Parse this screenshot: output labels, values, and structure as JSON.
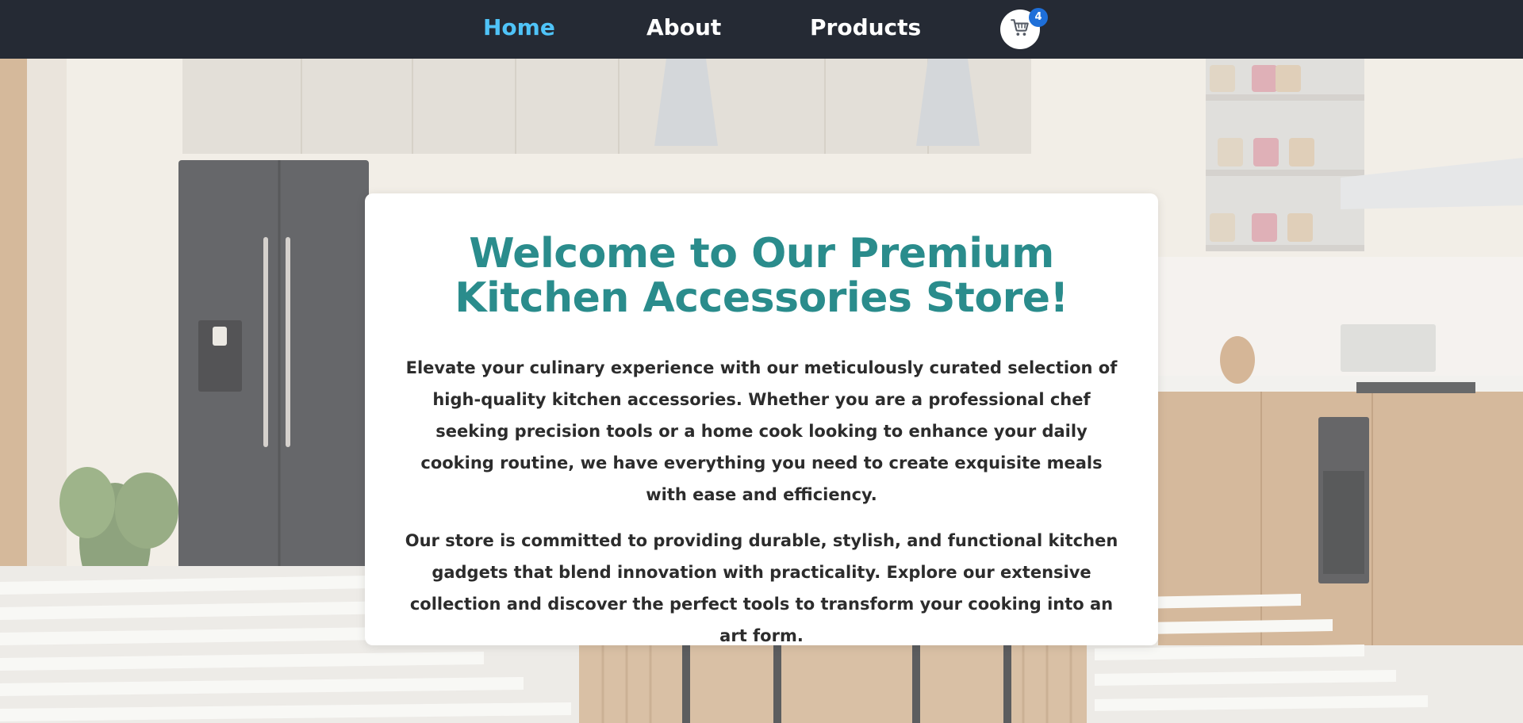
{
  "nav": {
    "items": [
      {
        "label": "Home",
        "active": true
      },
      {
        "label": "About",
        "active": false
      },
      {
        "label": "Products",
        "active": false
      }
    ],
    "cart": {
      "icon": "cart-icon",
      "count": "4"
    }
  },
  "hero": {
    "title": "Welcome to Our Premium Kitchen Accessories Store!",
    "paragraphs": [
      "Elevate your culinary experience with our meticulously curated selection of high-quality kitchen accessories. Whether you are a professional chef seeking precision tools or a home cook looking to enhance your daily cooking routine, we have everything you need to create exquisite meals with ease and efficiency.",
      "Our store is committed to providing durable, stylish, and functional kitchen gadgets that blend innovation with practicality. Explore our extensive collection and discover the perfect tools to transform your cooking into an art form."
    ]
  },
  "colors": {
    "navbar_bg": "#252a34",
    "nav_active": "#4fc3f7",
    "title": "#2a8c8c",
    "badge": "#1e6fd9"
  }
}
